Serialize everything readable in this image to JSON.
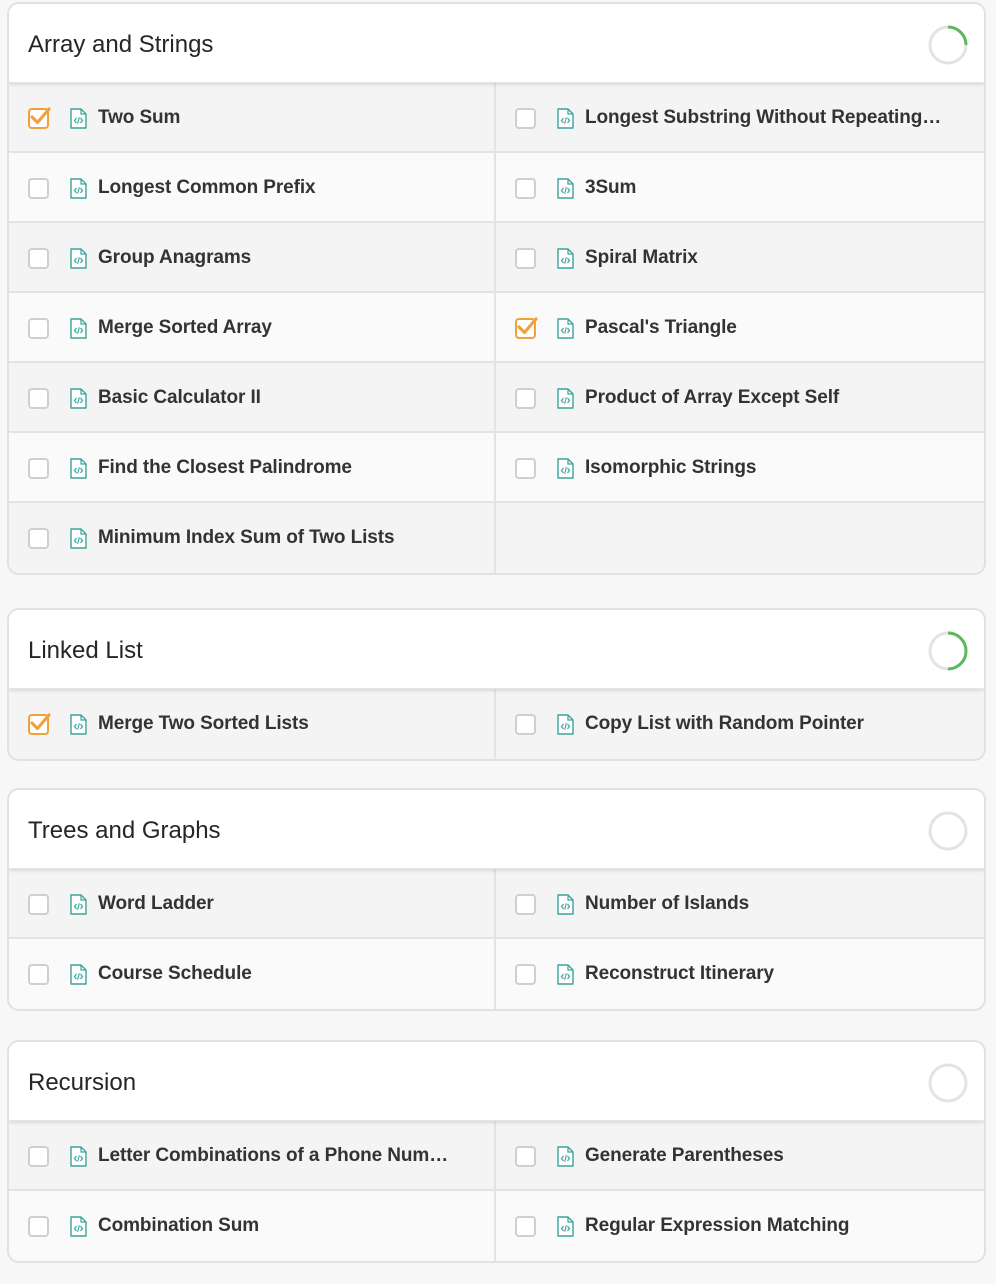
{
  "colors": {
    "check_accent": "#f0a13b",
    "progress_accent": "#5cb85c",
    "file_icon": "#3aa39b"
  },
  "sections": [
    {
      "title": "Array and Strings",
      "progress": 0.25,
      "items": [
        {
          "label": "Two Sum",
          "checked": true
        },
        {
          "label": "Longest Substring Without Repeating…",
          "checked": false
        },
        {
          "label": "Longest Common Prefix",
          "checked": false
        },
        {
          "label": "3Sum",
          "checked": false
        },
        {
          "label": "Group Anagrams",
          "checked": false
        },
        {
          "label": "Spiral Matrix",
          "checked": false
        },
        {
          "label": "Merge Sorted Array",
          "checked": false
        },
        {
          "label": "Pascal's Triangle",
          "checked": true
        },
        {
          "label": "Basic Calculator II",
          "checked": false
        },
        {
          "label": "Product of Array Except Self",
          "checked": false
        },
        {
          "label": "Find the Closest Palindrome",
          "checked": false
        },
        {
          "label": "Isomorphic Strings",
          "checked": false
        },
        {
          "label": "Minimum Index Sum of Two Lists",
          "checked": false
        }
      ]
    },
    {
      "title": "Linked List",
      "progress": 0.5,
      "items": [
        {
          "label": "Merge Two Sorted Lists",
          "checked": true
        },
        {
          "label": "Copy List with Random Pointer",
          "checked": false
        }
      ]
    },
    {
      "title": "Trees and Graphs",
      "progress": 0,
      "items": [
        {
          "label": "Word Ladder",
          "checked": false
        },
        {
          "label": "Number of Islands",
          "checked": false
        },
        {
          "label": "Course Schedule",
          "checked": false
        },
        {
          "label": "Reconstruct Itinerary",
          "checked": false
        }
      ]
    },
    {
      "title": "Recursion",
      "progress": 0,
      "items": [
        {
          "label": "Letter Combinations of a Phone Num…",
          "checked": false
        },
        {
          "label": "Generate Parentheses",
          "checked": false
        },
        {
          "label": "Combination Sum",
          "checked": false
        },
        {
          "label": "Regular Expression Matching",
          "checked": false
        }
      ]
    }
  ]
}
